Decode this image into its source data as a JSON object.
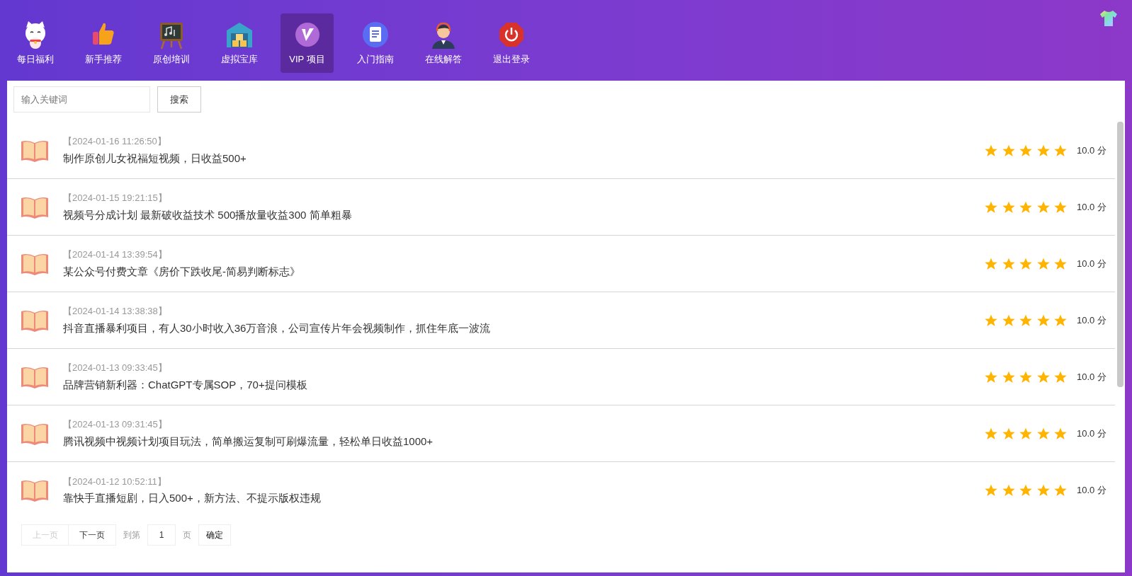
{
  "nav": [
    {
      "label": "每日福利",
      "selected": false
    },
    {
      "label": "新手推荐",
      "selected": false
    },
    {
      "label": "原创培训",
      "selected": false
    },
    {
      "label": "虚拟宝库",
      "selected": false
    },
    {
      "label": "VIP 项目",
      "selected": true
    },
    {
      "label": "入门指南",
      "selected": false
    },
    {
      "label": "在线解答",
      "selected": false
    },
    {
      "label": "退出登录",
      "selected": false
    }
  ],
  "search": {
    "placeholder": "输入关键词",
    "button": "搜索"
  },
  "articles": [
    {
      "date": "【2024-01-16 11:26:50】",
      "title": "制作原创儿女祝福短视频，日收益500+",
      "stars": 5,
      "score": "10.0 分"
    },
    {
      "date": "【2024-01-15 19:21:15】",
      "title": "视频号分成计划 最新破收益技术 500播放量收益300 简单粗暴",
      "stars": 5,
      "score": "10.0 分"
    },
    {
      "date": "【2024-01-14 13:39:54】",
      "title": "某公众号付费文章《房价下跌收尾-简易判断标志》",
      "stars": 5,
      "score": "10.0 分"
    },
    {
      "date": "【2024-01-14 13:38:38】",
      "title": "抖音直播暴利项目，有人30小时收入36万音浪，公司宣传片年会视频制作，抓住年底一波流",
      "stars": 5,
      "score": "10.0 分"
    },
    {
      "date": "【2024-01-13 09:33:45】",
      "title": "品牌营销新利器：ChatGPT专属SOP，70+提问模板",
      "stars": 5,
      "score": "10.0 分"
    },
    {
      "date": "【2024-01-13 09:31:45】",
      "title": "腾讯视频中视频计划项目玩法，简单搬运复制可刷爆流量，轻松单日收益1000+",
      "stars": 5,
      "score": "10.0 分"
    },
    {
      "date": "【2024-01-12 10:52:11】",
      "title": "靠快手直播短剧，日入500+，新方法、不提示版权违规",
      "stars": 5,
      "score": "10.0 分"
    }
  ],
  "pagination": {
    "prev": {
      "label": "上一页",
      "disabled": true
    },
    "next": {
      "label": "下一页",
      "disabled": false
    },
    "goto_label": "到第",
    "page": "1",
    "page_label": "页",
    "confirm": "确定"
  }
}
